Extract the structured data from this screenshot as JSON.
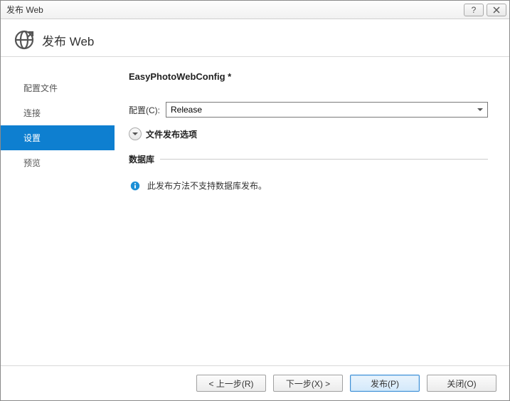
{
  "window": {
    "title": "发布 Web"
  },
  "header": {
    "title": "发布 Web"
  },
  "sidebar": {
    "items": [
      {
        "label": "配置文件"
      },
      {
        "label": "连接"
      },
      {
        "label": "设置"
      },
      {
        "label": "预览"
      }
    ],
    "activeIndex": 2
  },
  "main": {
    "profileTitle": "EasyPhotoWebConfig *",
    "configLabel": "配置(C):",
    "configValue": "Release",
    "expanderLabel": "文件发布选项",
    "dbSectionTitle": "数据库",
    "dbInfoMessage": "此发布方法不支持数据库发布。"
  },
  "footer": {
    "prev": "< 上一步(R)",
    "next": "下一步(X) >",
    "publish": "发布(P)",
    "close": "关闭(O)"
  }
}
